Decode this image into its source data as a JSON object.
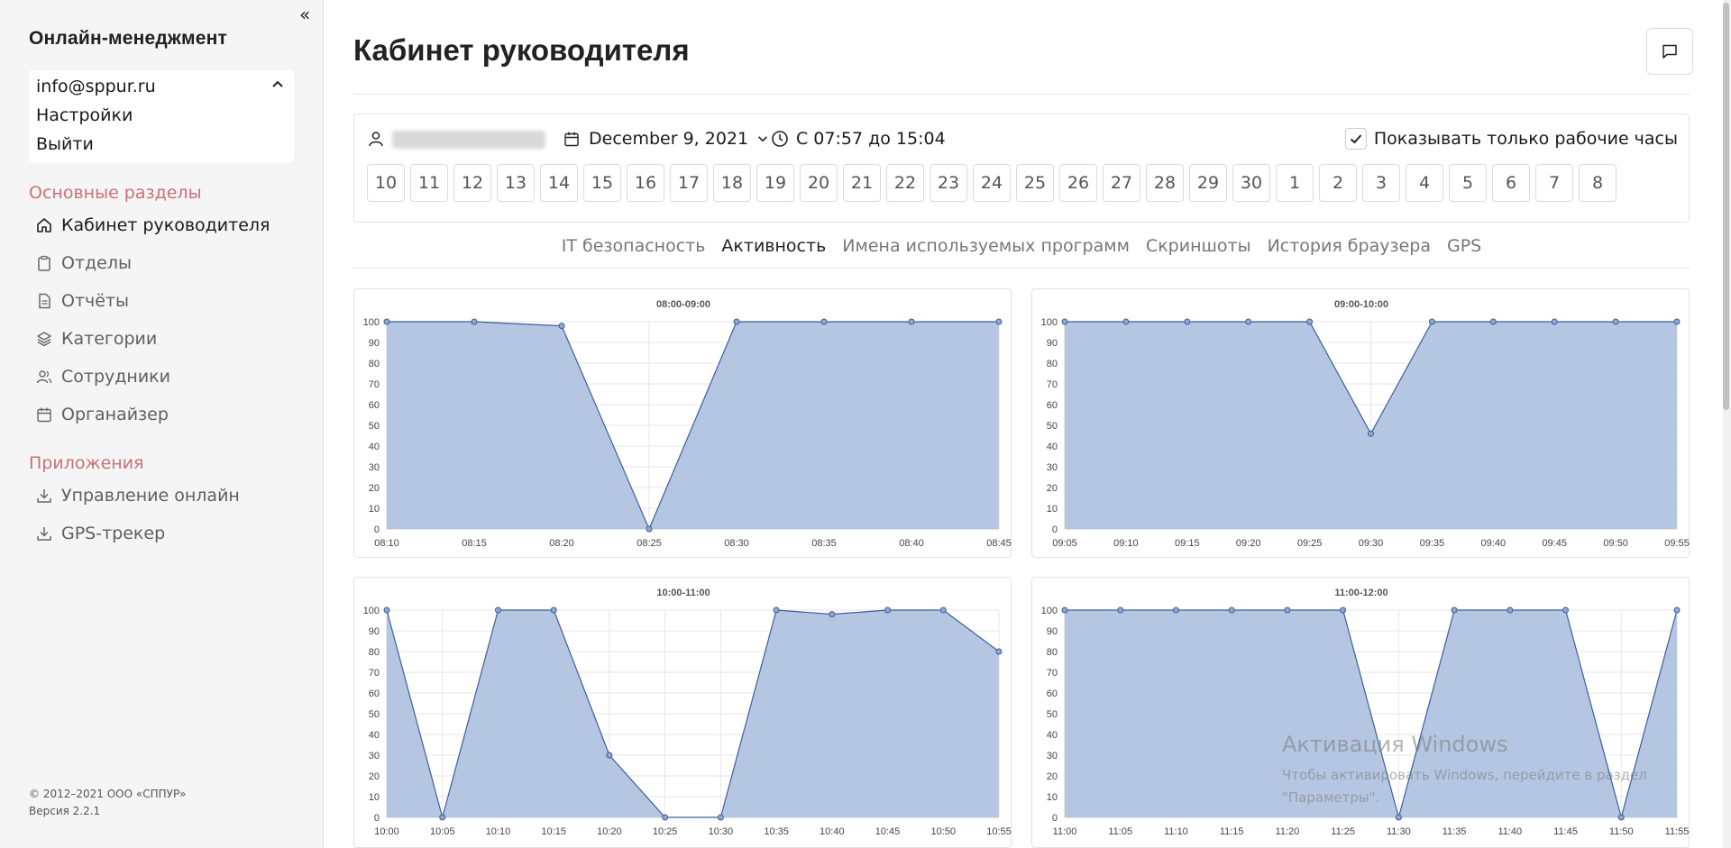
{
  "sidebar": {
    "brand": "Онлайн-менеджмент",
    "collapse_icon": "«",
    "account": {
      "email": "info@sppur.ru",
      "settings": "Настройки",
      "logout": "Выйти"
    },
    "sections": [
      {
        "title": "Основные разделы"
      },
      {
        "title": "Приложения"
      }
    ],
    "main_items": [
      {
        "label": "Кабинет руководителя",
        "icon": "home-icon",
        "active": true
      },
      {
        "label": "Отделы",
        "icon": "clipboard-icon"
      },
      {
        "label": "Отчёты",
        "icon": "document-icon"
      },
      {
        "label": "Категории",
        "icon": "layers-icon"
      },
      {
        "label": "Сотрудники",
        "icon": "users-icon"
      },
      {
        "label": "Органайзер",
        "icon": "calendar-icon"
      }
    ],
    "app_items": [
      {
        "label": "Управление онлайн",
        "icon": "download-icon"
      },
      {
        "label": "GPS-трекер",
        "icon": "download-icon"
      }
    ],
    "footer": {
      "copyright": "© 2012–2021 ООО «СППУР»",
      "version": "Версия 2.2.1"
    }
  },
  "main": {
    "title": "Кабинет руководителя",
    "filters": {
      "date": "December 9, 2021",
      "time_range": "С 07:57 до 15:04",
      "work_hours_label": "Показывать только рабочие часы",
      "work_hours_checked": true,
      "days": [
        "10",
        "11",
        "12",
        "13",
        "14",
        "15",
        "16",
        "17",
        "18",
        "19",
        "20",
        "21",
        "22",
        "23",
        "24",
        "25",
        "26",
        "27",
        "28",
        "29",
        "30",
        "1",
        "2",
        "3",
        "4",
        "5",
        "6",
        "7",
        "8"
      ]
    },
    "tabs": [
      {
        "label": "IT безопасность"
      },
      {
        "label": "Активность",
        "active": true
      },
      {
        "label": "Имена используемых программ"
      },
      {
        "label": "Скриншоты"
      },
      {
        "label": "История браузера"
      },
      {
        "label": "GPS"
      }
    ]
  },
  "colors": {
    "area_fill": "#b1c3e0",
    "line": "#3d5f9c",
    "point_fill": "#90a8d0",
    "section_title": "#c9707a"
  },
  "chart_data": [
    {
      "type": "area",
      "title": "08:00-09:00",
      "x": [
        "08:10",
        "08:15",
        "08:20",
        "08:25",
        "08:30",
        "08:35",
        "08:40",
        "08:45"
      ],
      "values": [
        100,
        100,
        98,
        0,
        100,
        100,
        100,
        100
      ],
      "yticks": [
        0,
        10,
        20,
        30,
        40,
        50,
        60,
        70,
        80,
        90,
        100
      ],
      "ylim": [
        0,
        100
      ],
      "grid": true
    },
    {
      "type": "area",
      "title": "09:00-10:00",
      "x": [
        "09:05",
        "09:10",
        "09:15",
        "09:20",
        "09:25",
        "09:30",
        "09:35",
        "09:40",
        "09:45",
        "09:50",
        "09:55"
      ],
      "values": [
        100,
        100,
        100,
        100,
        100,
        46,
        100,
        100,
        100,
        100,
        100
      ],
      "yticks": [
        0,
        10,
        20,
        30,
        40,
        50,
        60,
        70,
        80,
        90,
        100
      ],
      "ylim": [
        0,
        100
      ],
      "grid": true
    },
    {
      "type": "area",
      "title": "10:00-11:00",
      "x": [
        "10:00",
        "10:05",
        "10:10",
        "10:15",
        "10:20",
        "10:25",
        "10:30",
        "10:35",
        "10:40",
        "10:45",
        "10:50",
        "10:55"
      ],
      "values": [
        100,
        0,
        100,
        100,
        30,
        0,
        0,
        100,
        98,
        100,
        100,
        80
      ],
      "yticks": [
        0,
        10,
        20,
        30,
        40,
        50,
        60,
        70,
        80,
        90,
        100
      ],
      "ylim": [
        0,
        100
      ],
      "grid": true
    },
    {
      "type": "area",
      "title": "11:00-12:00",
      "x": [
        "11:00",
        "11:05",
        "11:10",
        "11:15",
        "11:20",
        "11:25",
        "11:30",
        "11:35",
        "11:40",
        "11:45",
        "11:50",
        "11:55"
      ],
      "values": [
        100,
        100,
        100,
        100,
        100,
        100,
        0,
        100,
        100,
        100,
        0,
        100
      ],
      "yticks": [
        0,
        10,
        20,
        30,
        40,
        50,
        60,
        70,
        80,
        90,
        100
      ],
      "ylim": [
        0,
        100
      ],
      "grid": true
    }
  ],
  "watermark": {
    "line1": "Активация Windows",
    "line2": "Чтобы активировать Windows, перейдите в раздел \"Параметры\"."
  }
}
